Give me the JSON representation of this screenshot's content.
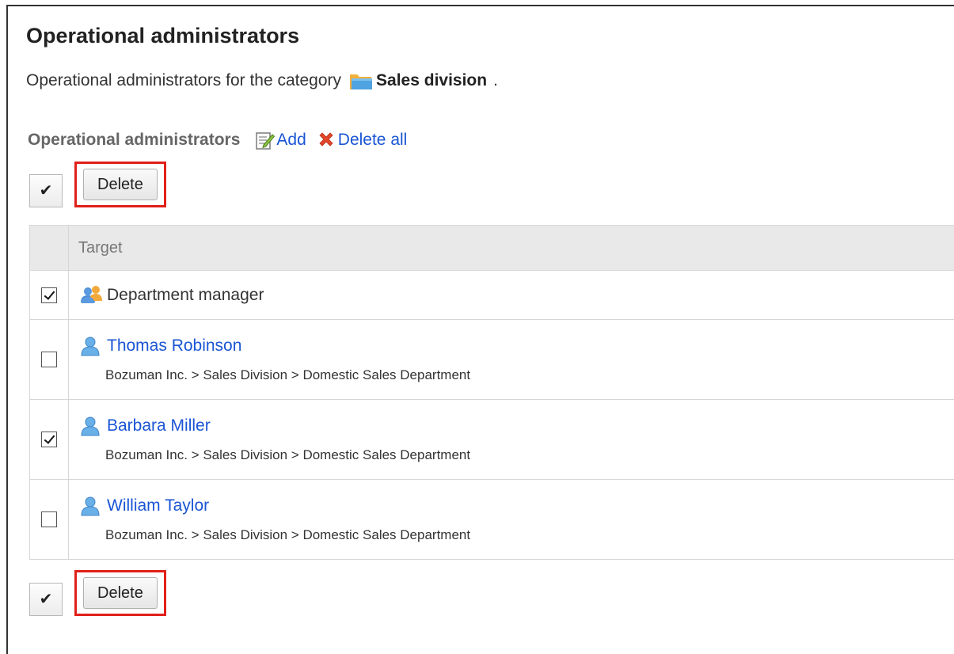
{
  "page": {
    "title": "Operational administrators",
    "description_prefix": "Operational administrators for the category",
    "category_name": "Sales division",
    "description_suffix": "."
  },
  "section": {
    "title": "Operational administrators",
    "add_label": "Add",
    "delete_all_label": "Delete all"
  },
  "toolbar": {
    "check_all_symbol": "✔",
    "delete_label": "Delete"
  },
  "table": {
    "header_target": "Target",
    "rows": [
      {
        "type": "role",
        "name": "Department manager",
        "checked": true,
        "path": ""
      },
      {
        "type": "user",
        "name": "Thomas Robinson",
        "checked": false,
        "path": "Bozuman Inc. > Sales Division > Domestic Sales Department"
      },
      {
        "type": "user",
        "name": "Barbara Miller",
        "checked": true,
        "path": "Bozuman Inc. > Sales Division > Domestic Sales Department"
      },
      {
        "type": "user",
        "name": "William Taylor",
        "checked": false,
        "path": "Bozuman Inc. > Sales Division > Domestic Sales Department"
      }
    ]
  },
  "colors": {
    "link": "#1a55d4",
    "highlight": "#e0201a",
    "header_bg": "#e9e9e9",
    "folder": "#4fa3e0",
    "user_icon": "#6ab0e8"
  },
  "icons": {
    "folder": "folder-icon",
    "add": "edit-note-icon",
    "delete_all": "red-x-icon",
    "role": "users-group-icon",
    "user": "user-icon"
  }
}
